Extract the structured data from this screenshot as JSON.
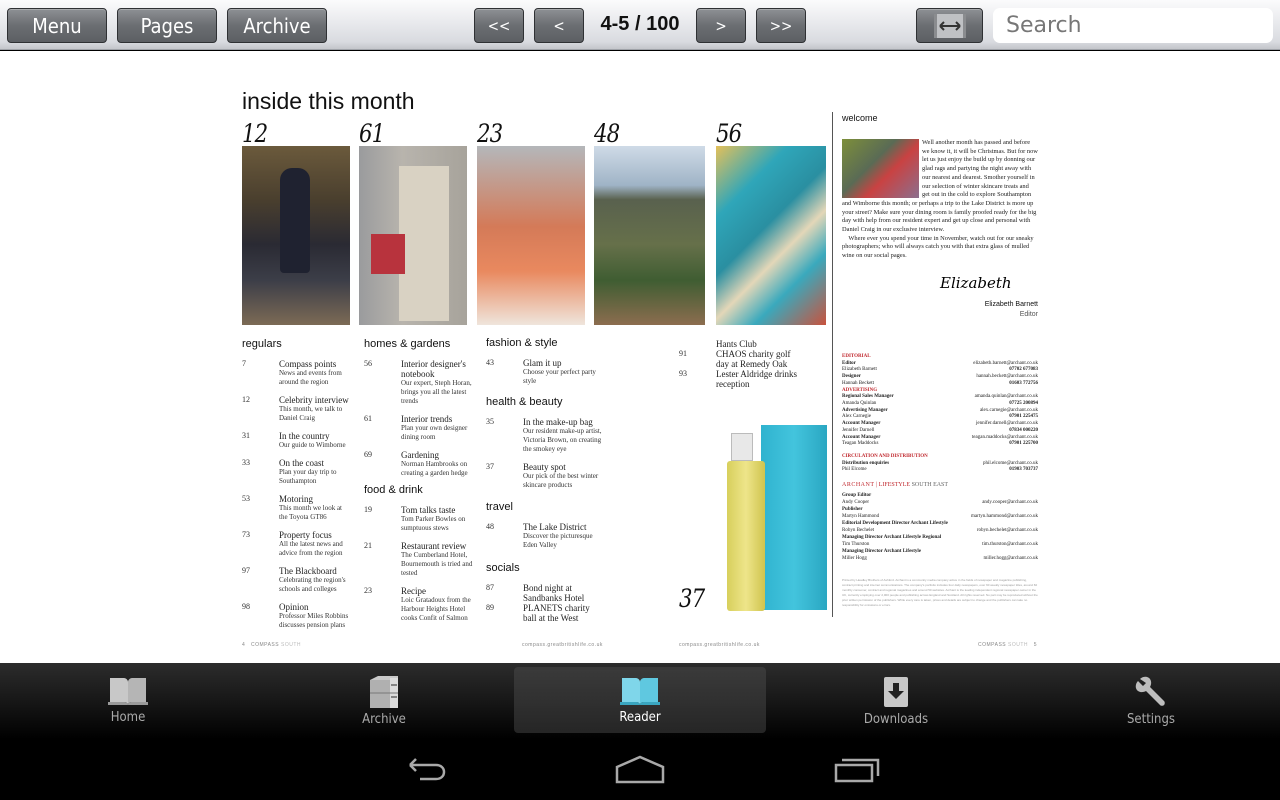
{
  "toolbar": {
    "menu_label": "Menu",
    "pages_label": "Pages",
    "archive_label": "Archive",
    "first_label": "<<",
    "prev_label": "<",
    "page_indicator": "4-5 / 100",
    "next_label": ">",
    "last_label": ">>",
    "fit_width_icon": "fit-width-icon",
    "search_placeholder": "Search"
  },
  "magazine": {
    "title": "inside this month",
    "features": [
      {
        "page": "12",
        "image": "man in suit seated"
      },
      {
        "page": "61",
        "image": "dresser and dining chair"
      },
      {
        "page": "23",
        "image": "salmon with rosemary"
      },
      {
        "page": "48",
        "image": "lake district hills"
      },
      {
        "page": "56",
        "image": "patterned wallpaper rolls"
      }
    ],
    "sections": {
      "regulars": {
        "heading": "regulars",
        "entries": [
          {
            "page": "7",
            "title": "Compass points",
            "desc": "News and events from around the region"
          },
          {
            "page": "12",
            "title": "Celebrity interview",
            "desc": "This month, we talk to Daniel Craig"
          },
          {
            "page": "31",
            "title": "In the country",
            "desc": "Our guide to Wimborne"
          },
          {
            "page": "33",
            "title": "On the coast",
            "desc": "Plan your day trip to Southampton"
          },
          {
            "page": "53",
            "title": "Motoring",
            "desc": "This month we look at the Toyota GT86"
          },
          {
            "page": "73",
            "title": "Property focus",
            "desc": "All the latest news and advice from the region"
          },
          {
            "page": "97",
            "title": "The Blackboard",
            "desc": "Celebrating the region's schools and colleges"
          },
          {
            "page": "98",
            "title": "Opinion",
            "desc": "Professor Miles Robbins discusses pension plans"
          }
        ]
      },
      "homes": {
        "heading": "homes & gardens",
        "entries": [
          {
            "page": "56",
            "title": "Interior designer's notebook",
            "desc": "Our expert, Steph Horan, brings you all the latest trends"
          },
          {
            "page": "61",
            "title": "Interior trends",
            "desc": "Plan your own designer dining room"
          },
          {
            "page": "69",
            "title": "Gardening",
            "desc": "Norman Hambrooks on creating a garden hedge"
          }
        ]
      },
      "food": {
        "heading": "food & drink",
        "entries": [
          {
            "page": "19",
            "title": "Tom talks taste",
            "desc": "Tom Parker Bowles on sumptuous stews"
          },
          {
            "page": "21",
            "title": "Restaurant review",
            "desc": "The Cumberland Hotel, Bournemouth is tried and tested"
          },
          {
            "page": "23",
            "title": "Recipe",
            "desc": "Loic Gratadoux from the Harbour Heights Hotel cooks Confit of Salmon"
          }
        ]
      },
      "fashion": {
        "heading": "fashion & style",
        "entries": [
          {
            "page": "43",
            "title": "Glam it up",
            "desc": "Choose your perfect party style"
          }
        ]
      },
      "health": {
        "heading": "health & beauty",
        "entries": [
          {
            "page": "35",
            "title": "In the make-up bag",
            "desc": "Our resident make-up artist, Victoria Brown, on creating the smokey eye"
          },
          {
            "page": "37",
            "title": "Beauty spot",
            "desc": "Our pick of the best winter skincare products"
          }
        ]
      },
      "travel": {
        "heading": "travel",
        "entries": [
          {
            "page": "48",
            "title": "The Lake District",
            "desc": "Discover the picturesque Eden Valley"
          }
        ]
      },
      "socials": {
        "heading": "socials",
        "entries": [
          {
            "page": "87",
            "title": "Bond night at Sandbanks Hotel",
            "desc": ""
          },
          {
            "page": "89",
            "title": "PLANETS charity ball at the West",
            "desc": ""
          }
        ],
        "continued": [
          {
            "page": "",
            "title": "Hants Club"
          },
          {
            "page": "91",
            "title": "CHAOS charity golf day at Remedy Oak"
          },
          {
            "page": "93",
            "title": "Lester Aldridge drinks reception"
          }
        ]
      }
    },
    "product_page": "37",
    "footer_left": {
      "page": "4",
      "brand": "COMPASS",
      "region": "SOUTH",
      "url": "compass.greatbritishlife.co.uk"
    },
    "footer_right": {
      "page": "5",
      "brand": "COMPASS",
      "region": "SOUTH",
      "url": "compass.greatbritishlife.co.uk"
    },
    "welcome": {
      "heading": "welcome",
      "text1": "Well another month has passed and before we know it, it will be Christmas. But for now let us just enjoy the build up by donning our glad rags and partying the night away with our nearest and dearest. Smother yourself in our selection of winter skincare treats and get out in the cold to explore Southampton and Wimborne this month; or perhaps a trip to the Lake District is more up your street? Make sure your dining room is family proofed ready for the big day with help from our resident expert and get up close and personal with Daniel Craig in our exclusive interview.",
      "text2": "Where ever you spend your time in November, watch out for our sneaky photographers; who will always catch you with that extra glass of mulled wine on our social pages.",
      "signature": "Elizabeth",
      "editor_name": "Elizabeth Barnett",
      "editor_role": "Editor"
    },
    "contacts": [
      {
        "label": "EDITORIAL",
        "kind": "section"
      },
      {
        "label": "Editor",
        "name": "Elizabeth Barnett",
        "email": "elizabeth.barnett@archant.co.uk",
        "phone": "07702 677083"
      },
      {
        "label": "Designer",
        "name": "Hannah Beckett",
        "email": "hannah.beckett@archant.co.uk",
        "phone": "01603 772756"
      },
      {
        "label": "ADVERTISING",
        "kind": "section"
      },
      {
        "label": "Regional Sales Manager",
        "name": "Amanda Quinlan",
        "email": "amanda.quinlan@archant.co.uk",
        "phone": "07725 200894"
      },
      {
        "label": "Advertising Manager",
        "name": "Alex Carnegie",
        "email": "alex.carnegie@archant.co.uk",
        "phone": "07901 225475"
      },
      {
        "label": "Account Manager",
        "name": "Jennifer Darnell",
        "email": "jennifer.darnell@archant.co.uk",
        "phone": "07834 000220"
      },
      {
        "label": "Account Manager",
        "name": "Teagan Maddocks",
        "email": "teagan.maddocks@archant.co.uk",
        "phone": "07901 225700"
      },
      {
        "label": "CIRCULATION AND DISTRIBUTION",
        "kind": "section"
      },
      {
        "label": "Distribution enquiries",
        "name": "Phil Elcome",
        "email": "phil.elcome@archant.co.uk",
        "phone": "01903 703737"
      }
    ],
    "archant_brand": "ARCHANT",
    "archant_sub": "LIFESTYLE",
    "archant_region": "SOUTH EAST",
    "archant_contacts": [
      {
        "label": "Group Editor",
        "name": "Andy Cooper",
        "email": "andy.cooper@archant.co.uk"
      },
      {
        "label": "Publisher",
        "name": "Martyn Hammond",
        "email": "martyn.hammond@archant.co.uk"
      },
      {
        "label": "Editorial Development Director Archant Lifestyle",
        "name": "Robyn Bechelet",
        "email": "robyn.bechelet@archant.co.uk"
      },
      {
        "label": "Managing Director Archant Lifestyle Regional",
        "name": "Tim Thurston",
        "email": "tim.thurston@archant.co.uk"
      },
      {
        "label": "Managing Director Archant Lifestyle",
        "name": "Miller Hogg",
        "email": "miller.hogg@archant.co.uk"
      }
    ],
    "fine_print": "Printed by Headley Brothers of Ashford. Archant is a community media company active in the fields of newspaper and magazine publishing, contract printing and internet communications. The company's portfolio includes four daily newspapers, over 60 weekly newspaper titles, around 60 monthly consumer, contract and regional magazines and around 50 websites. Archant is the leading independent regional newspaper owner in the UK, currently employing over 2,000 people and publishing across England and Scotland. All rights reserved. No part may be reproduced without the prior written permission of the publishers. While every care is taken, prices and details are subject to change and the publishers can take no responsibility for omissions or errors."
  },
  "tabbar": {
    "tabs": [
      {
        "label": "Home",
        "icon": "open-book-icon",
        "active": false
      },
      {
        "label": "Archive",
        "icon": "filing-cabinet-icon",
        "active": false
      },
      {
        "label": "Reader",
        "icon": "reader-book-icon",
        "active": true
      },
      {
        "label": "Downloads",
        "icon": "download-icon",
        "active": false
      },
      {
        "label": "Settings",
        "icon": "wrench-icon",
        "active": false
      }
    ],
    "accent": "#5fc8e0"
  },
  "navbar": {
    "back_icon": "back-icon",
    "home_icon": "home-icon",
    "recents_icon": "recent-apps-icon"
  }
}
